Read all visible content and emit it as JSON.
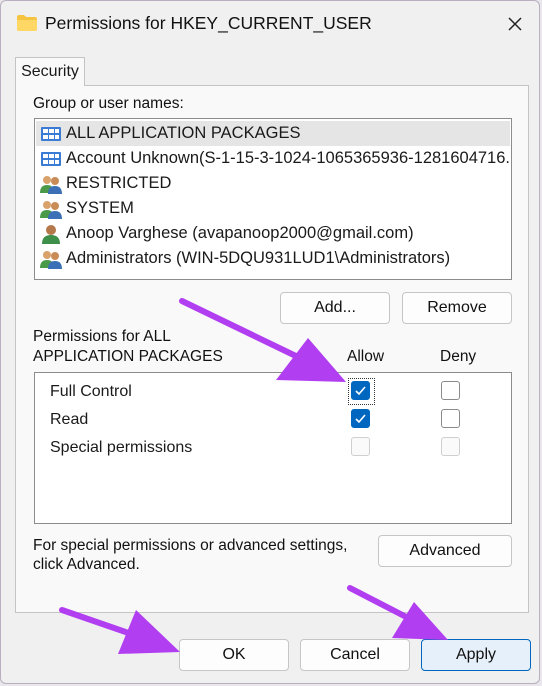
{
  "dialog": {
    "title": "Permissions for HKEY_CURRENT_USER",
    "tab_security": "Security"
  },
  "users": {
    "heading": "Group or user names:",
    "items": [
      {
        "label": "ALL APPLICATION PACKAGES",
        "icon": "app-packages-icon",
        "selected": true
      },
      {
        "label": "Account Unknown(S-1-15-3-1024-1065365936-1281604716...",
        "icon": "app-packages-icon"
      },
      {
        "label": "RESTRICTED",
        "icon": "group-users-icon"
      },
      {
        "label": "SYSTEM",
        "icon": "group-users-icon"
      },
      {
        "label": "Anoop Varghese (avapanoop2000@gmail.com)",
        "icon": "single-user-icon"
      },
      {
        "label": "Administrators (WIN-5DQU931LUD1\\Administrators)",
        "icon": "group-users-icon"
      }
    ],
    "add_label": "Add...",
    "remove_label": "Remove"
  },
  "permissions": {
    "heading_line1": "Permissions for ALL",
    "heading_line2": "APPLICATION PACKAGES",
    "allow_header": "Allow",
    "deny_header": "Deny",
    "rows": [
      {
        "name": "Full Control",
        "allow": true,
        "deny": false,
        "disabled": false
      },
      {
        "name": "Read",
        "allow": true,
        "deny": false,
        "disabled": false
      },
      {
        "name": "Special permissions",
        "allow": false,
        "deny": false,
        "disabled": true
      }
    ]
  },
  "advanced": {
    "text_line1": "For special permissions or advanced settings,",
    "text_line2": "click Advanced.",
    "button_label": "Advanced"
  },
  "footer": {
    "ok_label": "OK",
    "cancel_label": "Cancel",
    "apply_label": "Apply"
  },
  "colors": {
    "accent": "#0067c0",
    "annotation_arrow": "#b13ef0"
  }
}
